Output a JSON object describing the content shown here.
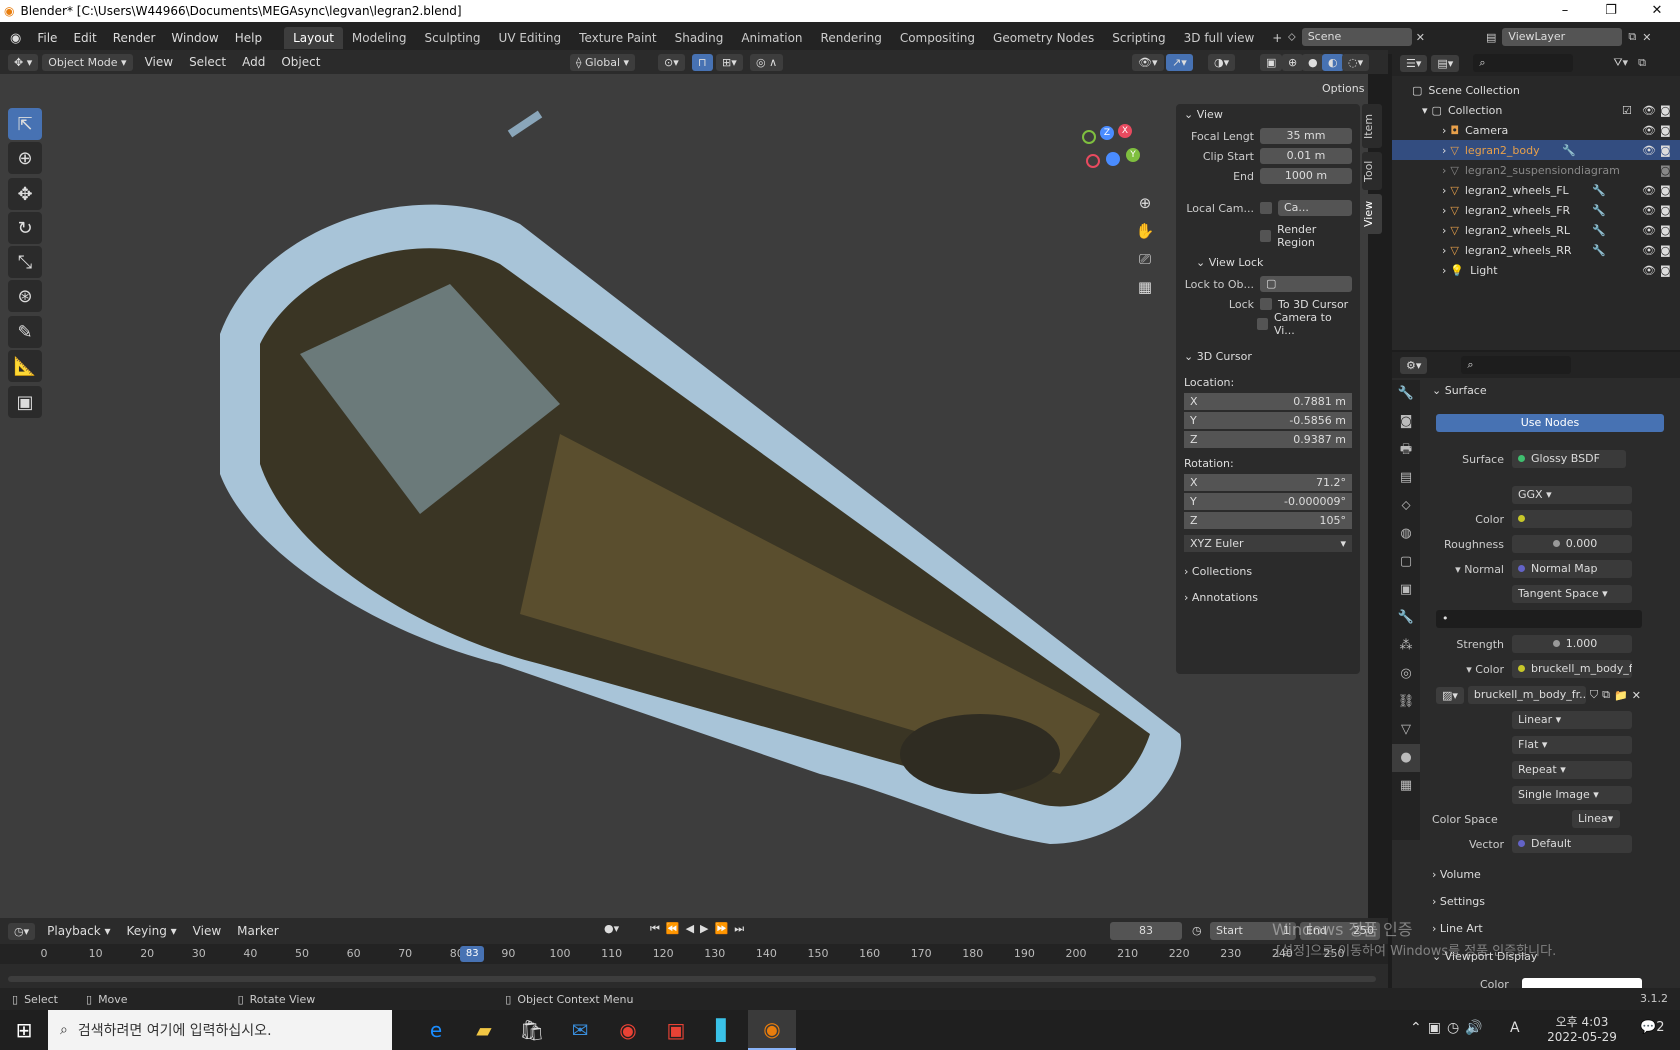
{
  "window": {
    "title": "Blender* [C:\\Users\\W44966\\Documents\\MEGAsync\\legvan\\legran2.blend]"
  },
  "menu": [
    "File",
    "Edit",
    "Render",
    "Window",
    "Help"
  ],
  "workspaces": [
    "Layout",
    "Modeling",
    "Sculpting",
    "UV Editing",
    "Texture Paint",
    "Shading",
    "Animation",
    "Rendering",
    "Compositing",
    "Geometry Nodes",
    "Scripting",
    "3D full view"
  ],
  "scene": "Scene",
  "view_layer": "ViewLayer",
  "viewport_header": {
    "mode": "Object Mode",
    "menus": [
      "View",
      "Select",
      "Add",
      "Object"
    ],
    "orientation": "Global",
    "options": "Options"
  },
  "npanel": {
    "tabs": [
      "Item",
      "Tool",
      "View"
    ],
    "view_title": "View",
    "focal_label": "Focal Lengt",
    "focal_value": "35 mm",
    "clip_start_label": "Clip Start",
    "clip_start_value": "0.01 m",
    "end_label": "End",
    "end_value": "1000 m",
    "local_cam_label": "Local Cam...",
    "local_cam_value": "Ca...",
    "render_region": "Render Region",
    "view_lock_title": "View Lock",
    "lock_to_obj": "Lock to Ob...",
    "lock": "Lock",
    "to_3d_cursor": "To 3D Cursor",
    "camera_to_view": "Camera to Vi...",
    "cursor_title": "3D Cursor",
    "location": "Location:",
    "loc": [
      {
        "a": "X",
        "v": "0.7881 m"
      },
      {
        "a": "Y",
        "v": "-0.5856 m"
      },
      {
        "a": "Z",
        "v": "0.9387 m"
      }
    ],
    "rotation": "Rotation:",
    "rot": [
      {
        "a": "X",
        "v": "71.2°"
      },
      {
        "a": "Y",
        "v": "-0.000009°"
      },
      {
        "a": "Z",
        "v": "105°"
      }
    ],
    "euler": "XYZ Euler",
    "collections": "Collections",
    "annotations": "Annotations"
  },
  "outliner": {
    "scene_collection": "Scene Collection",
    "collection": "Collection",
    "items": [
      {
        "name": "Camera"
      },
      {
        "name": "legran2_body"
      },
      {
        "name": "legran2_suspensiondiagram"
      },
      {
        "name": "legran2_wheels_FL"
      },
      {
        "name": "legran2_wheels_FR"
      },
      {
        "name": "legran2_wheels_RL"
      },
      {
        "name": "legran2_wheels_RR"
      },
      {
        "name": "Light"
      }
    ]
  },
  "properties": {
    "surface_panel": "Surface",
    "use_nodes": "Use Nodes",
    "surface_label": "Surface",
    "surface_value": "Glossy BSDF",
    "distribution": "GGX",
    "color_label": "Color",
    "roughness_label": "Roughness",
    "roughness_value": "0.000",
    "normal_label": "Normal",
    "normal_value": "Normal Map",
    "tangent": "Tangent Space",
    "strength_label": "Strength",
    "strength_value": "1.000",
    "color2_label": "Color",
    "color2_value": "bruckell_m_body_f...",
    "image_name": "bruckell_m_body_fr...",
    "interp": "Linear",
    "proj": "Flat",
    "ext": "Repeat",
    "source": "Single Image",
    "cs_label": "Color Space",
    "cs_value": "Linea",
    "vector_label": "Vector",
    "vector_value": "Default",
    "volume": "Volume",
    "settings": "Settings",
    "lineart": "Line Art",
    "viewport_display": "Viewport Display",
    "color3_label": "Color"
  },
  "timeline": {
    "menus": [
      "Playback",
      "Keying",
      "View",
      "Marker"
    ],
    "current": "83",
    "start_label": "Start",
    "start": "1",
    "end_label": "End",
    "end": "250",
    "ticks": [
      "0",
      "10",
      "20",
      "30",
      "40",
      "50",
      "60",
      "70",
      "80",
      "90",
      "100",
      "110",
      "120",
      "130",
      "140",
      "150",
      "160",
      "170",
      "180",
      "190",
      "200",
      "210",
      "220",
      "230",
      "240",
      "250"
    ]
  },
  "watermark": {
    "line1": "Windows 정품 인증",
    "line2": "[설정]으로 이동하여 Windows를 정품 인증합니다."
  },
  "status": {
    "select": "Select",
    "move": "Move",
    "rotate": "Rotate View",
    "context": "Object Context Menu",
    "version": "3.1.2"
  },
  "taskbar": {
    "search": "검색하려면 여기에 입력하십시오.",
    "time": "오후 4:03",
    "date": "2022-05-29",
    "ime": "A",
    "notif": "2"
  }
}
